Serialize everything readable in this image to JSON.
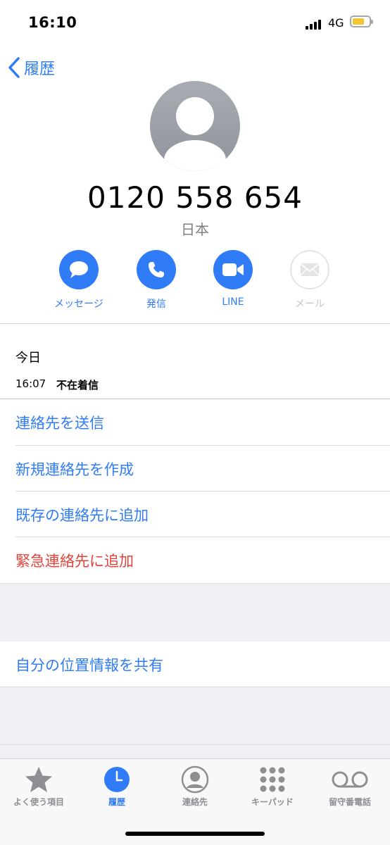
{
  "status": {
    "time": "16:10",
    "network": "4G"
  },
  "nav": {
    "back_label": "履歴"
  },
  "contact": {
    "number": "0120 558 654",
    "country": "日本"
  },
  "actions": [
    {
      "label": "メッセージ",
      "icon": "message-bubble-icon",
      "enabled": true
    },
    {
      "label": "発信",
      "icon": "phone-icon",
      "enabled": true
    },
    {
      "label": "LINE",
      "icon": "video-camera-icon",
      "enabled": true
    },
    {
      "label": "メール",
      "icon": "mail-icon",
      "enabled": false
    }
  ],
  "log": {
    "day": "今日",
    "time": "16:07",
    "type": "不在着信"
  },
  "menu": [
    "連絡先を送信",
    "新規連絡先を作成",
    "既存の連絡先に追加",
    "緊急連絡先に追加"
  ],
  "share_location": "自分の位置情報を共有",
  "tabs": [
    {
      "label": "よく使う項目",
      "icon": "star-icon",
      "active": false
    },
    {
      "label": "履歴",
      "icon": "clock-icon",
      "active": true
    },
    {
      "label": "連絡先",
      "icon": "person-circle-icon",
      "active": false
    },
    {
      "label": "キーパッド",
      "icon": "keypad-icon",
      "active": false
    },
    {
      "label": "留守番電話",
      "icon": "voicemail-icon",
      "active": false
    }
  ],
  "colors": {
    "accent": "#2f7cf6",
    "destructive": "#e1433b",
    "battery": "#f3c533"
  }
}
